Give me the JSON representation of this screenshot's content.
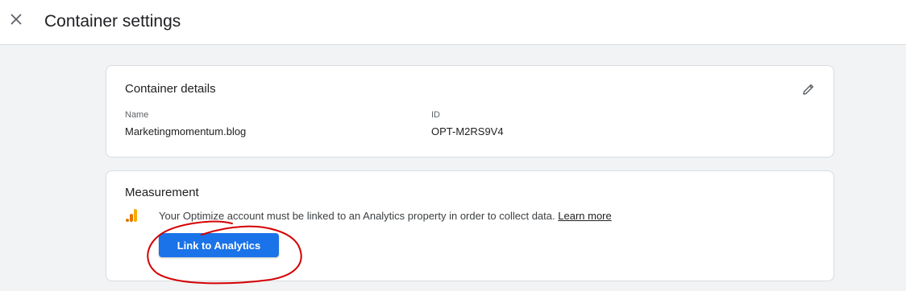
{
  "header": {
    "title": "Container settings",
    "close_icon": "close-icon"
  },
  "container_details": {
    "title": "Container details",
    "edit_icon": "pencil-icon",
    "name_label": "Name",
    "name_value": "Marketingmomentum.blog",
    "id_label": "ID",
    "id_value": "OPT-M2RS9V4"
  },
  "measurement": {
    "title": "Measurement",
    "icon": "analytics-icon",
    "message": "Your Optimize account must be linked to an Analytics property in order to collect data.",
    "learn_more": "Learn more",
    "link_button": "Link to Analytics"
  },
  "colors": {
    "primary_button": "#1a73e8",
    "analytics_orange": "#f9ab00",
    "analytics_dark_orange": "#e37400",
    "annotation_red": "#d50000"
  }
}
